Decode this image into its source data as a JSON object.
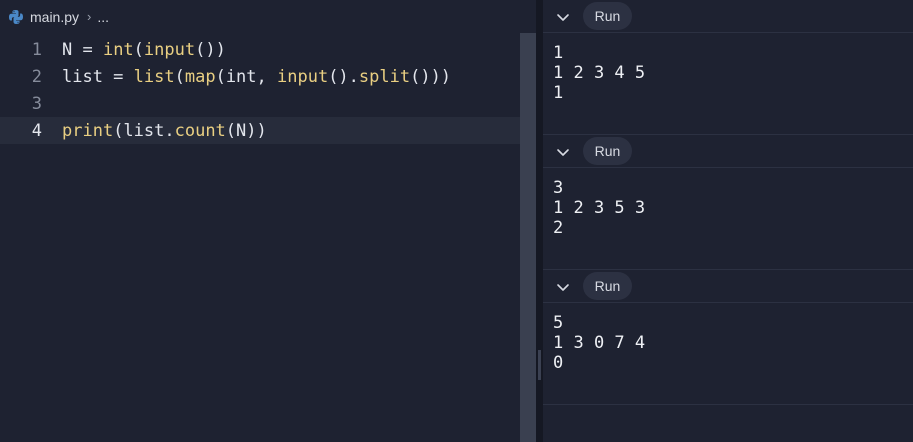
{
  "editor": {
    "filename": "main.py",
    "breadcrumb_more": "...",
    "lines": [
      {
        "number": "1",
        "text": "N = int(input())"
      },
      {
        "number": "2",
        "text": "list = list(map(int, input().split()))"
      },
      {
        "number": "3",
        "text": ""
      },
      {
        "number": "4",
        "text": "print(list.count(N))"
      }
    ],
    "active_line": 4
  },
  "runs": [
    {
      "button": "Run",
      "output": [
        "1",
        "1 2 3 4 5",
        "1"
      ]
    },
    {
      "button": "Run",
      "output": [
        "3",
        "1 2 3 5 3",
        "2"
      ]
    },
    {
      "button": "Run",
      "output": [
        "5",
        "1 3 0 7 4",
        "0"
      ]
    }
  ],
  "icons": {
    "file": "python-icon",
    "separator": "chevron-right-icon",
    "collapse": "chevron-down-icon"
  },
  "colors": {
    "background": "#1e2231",
    "function": "#e9cf82",
    "text": "#e2e5ec",
    "line_number": "#868c9b"
  }
}
